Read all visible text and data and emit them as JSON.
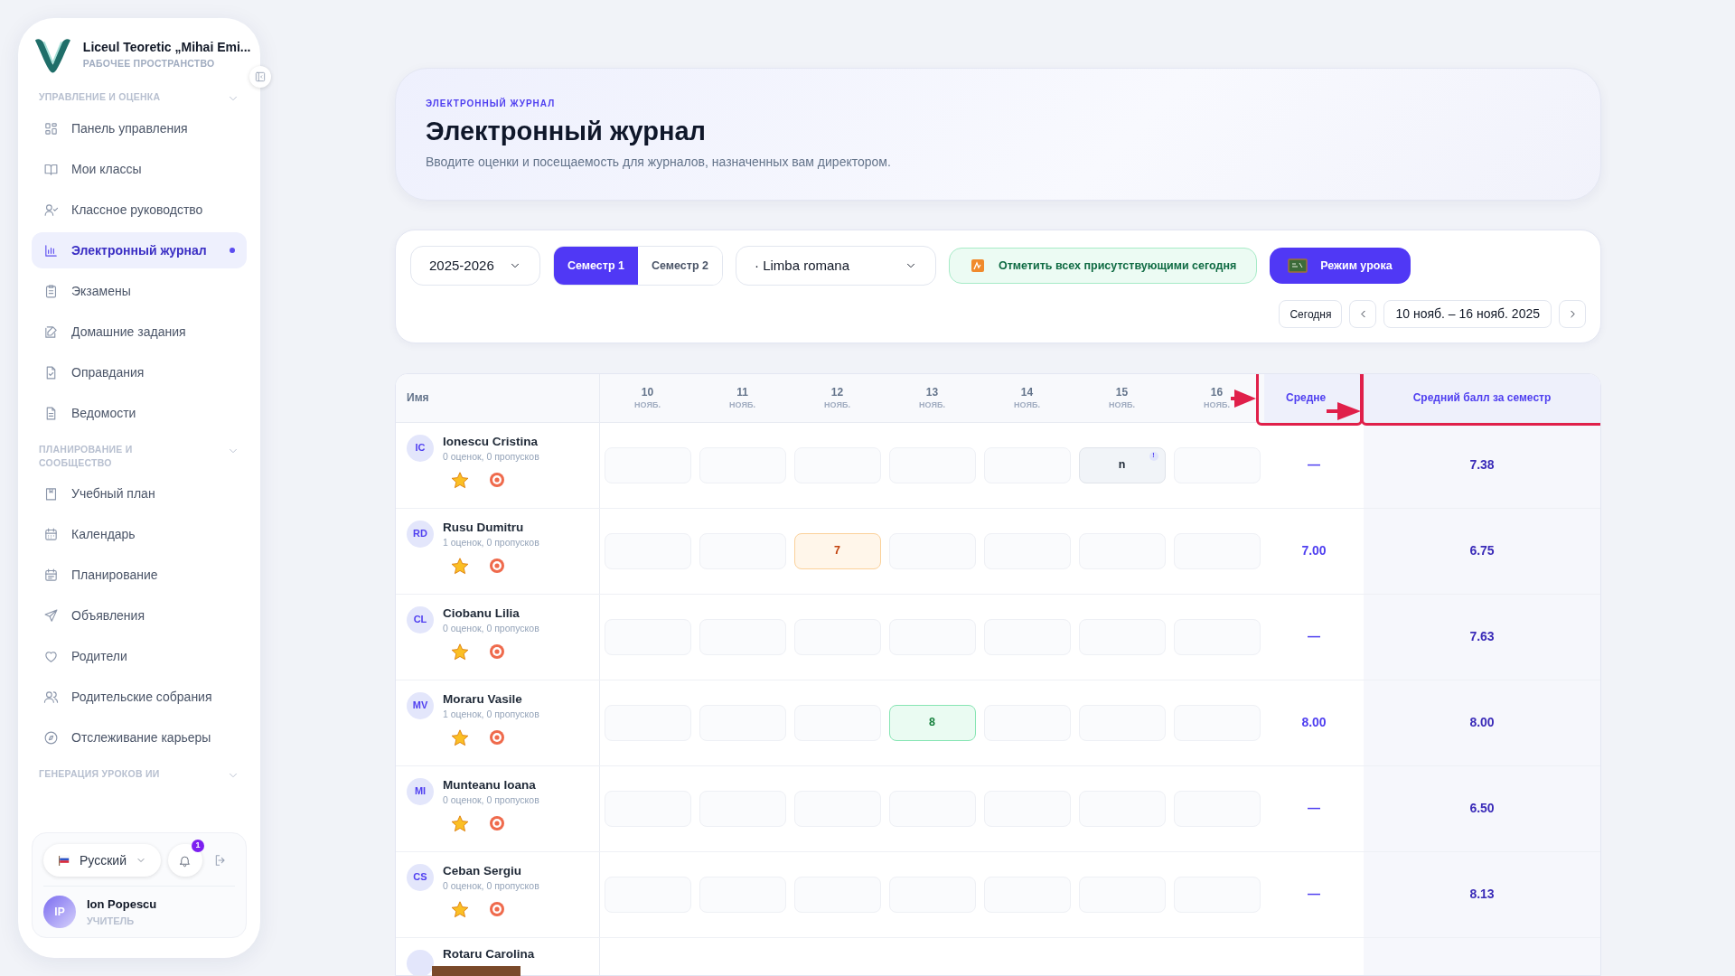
{
  "sidebar": {
    "school": "Liceul Teoretic „Mihai Emi...",
    "workspace": "РАБОЧЕЕ ПРОСТРАНСТВО",
    "sections": [
      {
        "title": "УПРАВЛЕНИЕ И ОЦЕНКА",
        "items": [
          {
            "label": "Панель управления",
            "selected": false
          },
          {
            "label": "Мои классы",
            "selected": false
          },
          {
            "label": "Классное руководство",
            "selected": false
          },
          {
            "label": "Электронный журнал",
            "selected": true
          },
          {
            "label": "Экзамены",
            "selected": false
          },
          {
            "label": "Домашние задания",
            "selected": false
          },
          {
            "label": "Оправдания",
            "selected": false
          },
          {
            "label": "Ведомости",
            "selected": false
          }
        ]
      },
      {
        "title": "ПЛАНИРОВАНИЕ И СООБЩЕСТВО",
        "items": [
          {
            "label": "Учебный план",
            "selected": false
          },
          {
            "label": "Календарь",
            "selected": false
          },
          {
            "label": "Планирование",
            "selected": false
          },
          {
            "label": "Объявления",
            "selected": false
          },
          {
            "label": "Родители",
            "selected": false
          },
          {
            "label": "Родительские собрания",
            "selected": false
          },
          {
            "label": "Отслеживание карьеры",
            "selected": false
          }
        ]
      },
      {
        "title": "ГЕНЕРАЦИЯ УРОКОВ ИИ"
      }
    ],
    "language": "Русский",
    "notifications": "1",
    "user": {
      "initials": "IP",
      "name": "Ion Popescu",
      "role": "УЧИТЕЛЬ"
    }
  },
  "header": {
    "eyebrow": "ЭЛЕКТРОННЫЙ ЖУРНАЛ",
    "title": "Электронный журнал",
    "subtitle": "Вводите оценки и посещаемость для журналов, назначенных вам директором."
  },
  "toolbar": {
    "year": "2025-2026",
    "semesters": [
      {
        "label": "Семестр 1",
        "selected": true
      },
      {
        "label": "Семестр 2",
        "selected": false
      }
    ],
    "subject": "· Limba romana",
    "mark_all": "Отметить всех присутствующими сегодня",
    "lesson_mode": "Режим урока",
    "today": "Сегодня",
    "range": "10 нояб. – 16 нояб. 2025"
  },
  "table": {
    "name_column": "Имя",
    "days": [
      {
        "day": "10",
        "month": "НОЯБ."
      },
      {
        "day": "11",
        "month": "НОЯБ."
      },
      {
        "day": "12",
        "month": "НОЯБ."
      },
      {
        "day": "13",
        "month": "НОЯБ."
      },
      {
        "day": "14",
        "month": "НОЯБ."
      },
      {
        "day": "15",
        "month": "НОЯБ."
      },
      {
        "day": "16",
        "month": "НОЯБ."
      }
    ],
    "average_column": "Средне",
    "semester_column": "Средний балл за семестр",
    "rows": [
      {
        "initials": "IC",
        "name": "Ionescu Cristina",
        "stats": "0 оценок, 0 пропусков",
        "cells": [
          {
            "kind": "empty"
          },
          {
            "kind": "empty"
          },
          {
            "kind": "empty"
          },
          {
            "kind": "empty"
          },
          {
            "kind": "empty"
          },
          {
            "kind": "absence",
            "value": "n",
            "note": "!"
          },
          {
            "kind": "empty"
          }
        ],
        "average": "—",
        "semester_average": "7.38"
      },
      {
        "initials": "RD",
        "name": "Rusu Dumitru",
        "stats": "1 оценок, 0 пропусков",
        "cells": [
          {
            "kind": "empty"
          },
          {
            "kind": "empty"
          },
          {
            "kind": "low",
            "value": "7"
          },
          {
            "kind": "empty"
          },
          {
            "kind": "empty"
          },
          {
            "kind": "empty"
          },
          {
            "kind": "empty"
          }
        ],
        "average": "7.00",
        "semester_average": "6.75"
      },
      {
        "initials": "CL",
        "name": "Ciobanu Lilia",
        "stats": "0 оценок, 0 пропусков",
        "cells": [
          {
            "kind": "empty"
          },
          {
            "kind": "empty"
          },
          {
            "kind": "empty"
          },
          {
            "kind": "empty"
          },
          {
            "kind": "empty"
          },
          {
            "kind": "empty"
          },
          {
            "kind": "empty"
          }
        ],
        "average": "—",
        "semester_average": "7.63"
      },
      {
        "initials": "MV",
        "name": "Moraru Vasile",
        "stats": "1 оценок, 0 пропусков",
        "cells": [
          {
            "kind": "empty"
          },
          {
            "kind": "empty"
          },
          {
            "kind": "empty"
          },
          {
            "kind": "high",
            "value": "8"
          },
          {
            "kind": "empty"
          },
          {
            "kind": "empty"
          },
          {
            "kind": "empty"
          }
        ],
        "average": "8.00",
        "semester_average": "8.00"
      },
      {
        "initials": "MI",
        "name": "Munteanu Ioana",
        "stats": "0 оценок, 0 пропусков",
        "cells": [
          {
            "kind": "empty"
          },
          {
            "kind": "empty"
          },
          {
            "kind": "empty"
          },
          {
            "kind": "empty"
          },
          {
            "kind": "empty"
          },
          {
            "kind": "empty"
          },
          {
            "kind": "empty"
          }
        ],
        "average": "—",
        "semester_average": "6.50"
      },
      {
        "initials": "CS",
        "name": "Ceban Sergiu",
        "stats": "0 оценок, 0 пропусков",
        "cells": [
          {
            "kind": "empty"
          },
          {
            "kind": "empty"
          },
          {
            "kind": "empty"
          },
          {
            "kind": "empty"
          },
          {
            "kind": "empty"
          },
          {
            "kind": "empty"
          },
          {
            "kind": "empty"
          }
        ],
        "average": "—",
        "semester_average": "8.13"
      },
      {
        "name": "Rotaru Carolina"
      }
    ]
  }
}
